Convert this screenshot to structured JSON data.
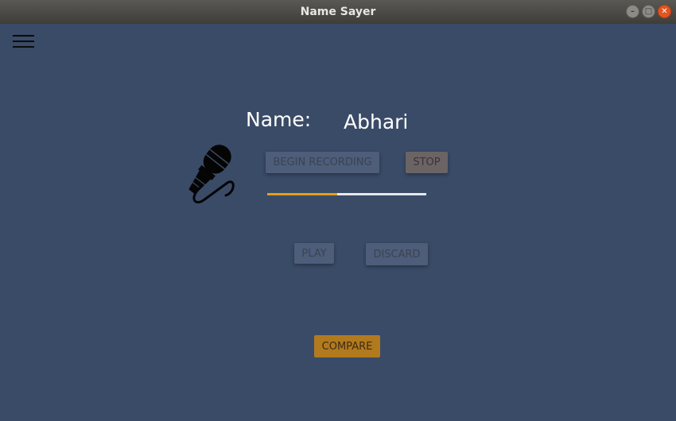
{
  "window": {
    "title": "Name Sayer",
    "controls": {
      "minimize_glyph": "–",
      "maximize_glyph": "□",
      "close_glyph": "✕"
    }
  },
  "menu": {
    "icon": "hamburger-menu-icon"
  },
  "name": {
    "label": "Name:",
    "value": "Abhari"
  },
  "recording": {
    "mic_icon": "microphone-icon",
    "begin_label": "BEGIN RECORDING",
    "stop_label": "STOP",
    "progress_fraction": 0.44
  },
  "playback": {
    "play_label": "PLAY",
    "discard_label": "DISCARD"
  },
  "compare": {
    "label": "COMPARE"
  },
  "colors": {
    "background": "#3a4b67",
    "button": "#4d5d7a",
    "stop_button": "#6b6465",
    "compare_button": "#b27a1e",
    "progress_fill": "#e3a019",
    "progress_track": "#e8e8ea"
  }
}
